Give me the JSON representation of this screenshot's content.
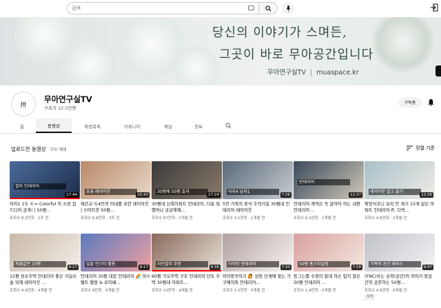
{
  "search": {
    "placeholder": "검색"
  },
  "banner": {
    "line1": "당신의 이야기가 스며든,",
    "line2": "그곳이 바로 무아공간입니다",
    "brand_name": "무아연구실TV",
    "brand_url": "muaspace.kr"
  },
  "channel": {
    "name": "무아연구실TV",
    "subscribers": "구독자 12.5만명",
    "subscribe_label": "구독중",
    "avatar_text": "卅"
  },
  "tabs": [
    "홈",
    "동영상",
    "재생목록",
    "커뮤니티",
    "채널",
    "정보"
  ],
  "section": {
    "title": "업로드한 동영상",
    "play_all": "모두 재생",
    "sort_label": "정렬 기준"
  },
  "videos": [
    {
      "title": "이이1 1도 ©= Colorful 의 소장 집 드디어 공개! | 50평...",
      "meta": "조회수 8.2만회 · 1주 전",
      "duration": "17:44",
      "band": "컬러 인테리어",
      "colors": [
        "#4a6a9a",
        "#1e2e4a"
      ],
      "progress": true
    },
    {
      "title": "재건교 두4인의 아내를 위한 레이아웃 | 스마트한 50평...",
      "meta": "조회수 6.8만회 · 3주 전",
      "duration": "15:43",
      "band": "초퓨 레이아웃",
      "colors": [
        "#b98a6a",
        "#e8d8c8"
      ],
      "progress": false
    },
    {
      "title": "30평대 신축아파트 인테리어, 다들 뭐했어나 궁금해해...",
      "meta": "조회수 67만회 · 1개월 전",
      "duration": "17:24",
      "band": "30평에 50평 효과",
      "colors": [
        "#3a3a3a",
        "#8a7a6a"
      ],
      "progress": false
    },
    {
      "title": "5인 가족의 휴식 주의거실 30평대 인테리어 레이아웃",
      "meta": "조회수 3.1만회 · 1개월 전",
      "duration": "7:26",
      "band": "어자4 남자1",
      "colors": [
        "#5a6a7a",
        "#c8ccd0"
      ],
      "progress": false
    },
    {
      "title": "인테리어 계약은 꼭 알아야 하는 내용 인테리어 ...",
      "meta": "조회수 6.1만회 · 1개월 전",
      "duration": "12:27",
      "band": "인테리어",
      "colors": [
        "#3a4a5a",
        "#d0c8b8"
      ],
      "progress": false
    },
    {
      "title": "확장식코니 유리 안 겪기 15개 같은 아파트 인테리어 ft. 다락...",
      "meta": "조회수 4.6만회 · 2개월 전",
      "duration": "12:26",
      "band": "레이아웃 알고 옮기",
      "colors": [
        "#a8c0c8",
        "#f0ece6"
      ],
      "progress": false
    },
    {
      "title": "15평 원소주택 인테리어 좋은 거실소슬 위해 레이아웃 ...",
      "meta": "조회수 4.9만회 · 4개월 전",
      "duration": "9:17",
      "band": "퍼즐같은 15평",
      "colors": [
        "#c8b8a8",
        "#f4efe8"
      ],
      "progress": false
    },
    {
      "title": "인테리어 30평 대문 인테리어 🌈 마스텔트 활용 & 로이베...",
      "meta": "조회수 8만회 · 4개월 전",
      "duration": "9:17",
      "band": "일들 인스타 활용",
      "colors": [
        "#5a7ac0",
        "#f0a0a0"
      ],
      "progress": false
    },
    {
      "title": "60평 가오주택 구조 인테리어 단독 주택 30평대 아파트...",
      "meta": "조회수 10만회 · 4개월 전",
      "duration": "8:36",
      "band": "라인컬러 주방",
      "colors": [
        "#8a6a5a",
        "#e8e0d8"
      ],
      "progress": true
    },
    {
      "title": "아이방꾸미기 🙋 성장 단계에 맞는 가구배치와 인테리어...",
      "meta": "조회수 1.5만회 · 5개월 전",
      "duration": "7:33",
      "band": "아이방 인테리어",
      "colors": [
        "#b0a0a0",
        "#f8f4f0"
      ],
      "progress": false
    },
    {
      "title": "동그는를 수정이 할데 하슨 입지 많은 50평 인테리어 ...",
      "meta": "조회수 1.9만회 · 5개월 전",
      "duration": "7:18",
      "band": "50평 홈스타일링",
      "colors": [
        "#d8a0a0",
        "#f4e8e0"
      ],
      "progress": false
    },
    {
      "title": "(FNC)쓰는 유학(공간)의 이야기 뭉공간의 공존하는 50평...",
      "meta": "조회수 4.6만회 · 6개월 전",
      "duration": "9:47",
      "band": "가족의 공간 테라스",
      "colors": [
        "#c0c0c8",
        "#f4f4f6"
      ],
      "progress": false,
      "badge": "자막"
    }
  ]
}
